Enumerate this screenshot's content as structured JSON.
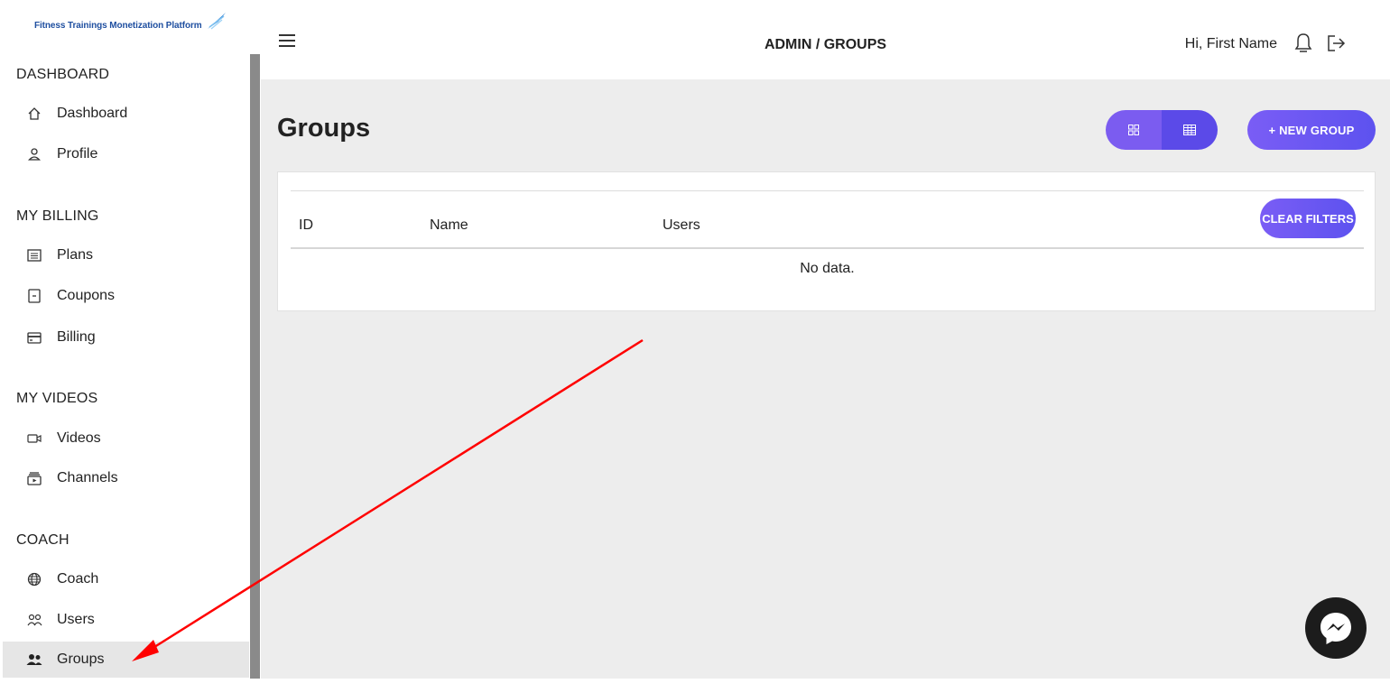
{
  "logo": {
    "text": "Fitness Trainings Monetization Platform"
  },
  "sidebar": {
    "sections": [
      {
        "heading": "DASHBOARD",
        "items": [
          {
            "label": "Dashboard",
            "icon": "home-icon"
          },
          {
            "label": "Profile",
            "icon": "user-icon"
          }
        ]
      },
      {
        "heading": "MY BILLING",
        "items": [
          {
            "label": "Plans",
            "icon": "list-icon"
          },
          {
            "label": "Coupons",
            "icon": "coupon-icon"
          },
          {
            "label": "Billing",
            "icon": "card-icon"
          }
        ]
      },
      {
        "heading": "MY VIDEOS",
        "items": [
          {
            "label": "Videos",
            "icon": "video-icon"
          },
          {
            "label": "Channels",
            "icon": "channel-icon"
          }
        ]
      },
      {
        "heading": "COACH",
        "items": [
          {
            "label": "Coach",
            "icon": "globe-icon"
          },
          {
            "label": "Users",
            "icon": "users-icon"
          },
          {
            "label": "Groups",
            "icon": "groups-icon",
            "active": true
          }
        ]
      }
    ]
  },
  "header": {
    "breadcrumb": "ADMIN / GROUPS",
    "greeting": "Hi, First Name"
  },
  "main": {
    "title": "Groups",
    "new_button": "+ NEW GROUP",
    "clear_filters": "CLEAR FILTERS",
    "table": {
      "columns": [
        "ID",
        "Name",
        "Users"
      ],
      "empty_text": "No data."
    }
  },
  "colors": {
    "accent": "#6a57f0",
    "annotation_arrow": "#ff0000",
    "active_item_bg": "#e6e6e6",
    "main_bg": "#ededed"
  }
}
